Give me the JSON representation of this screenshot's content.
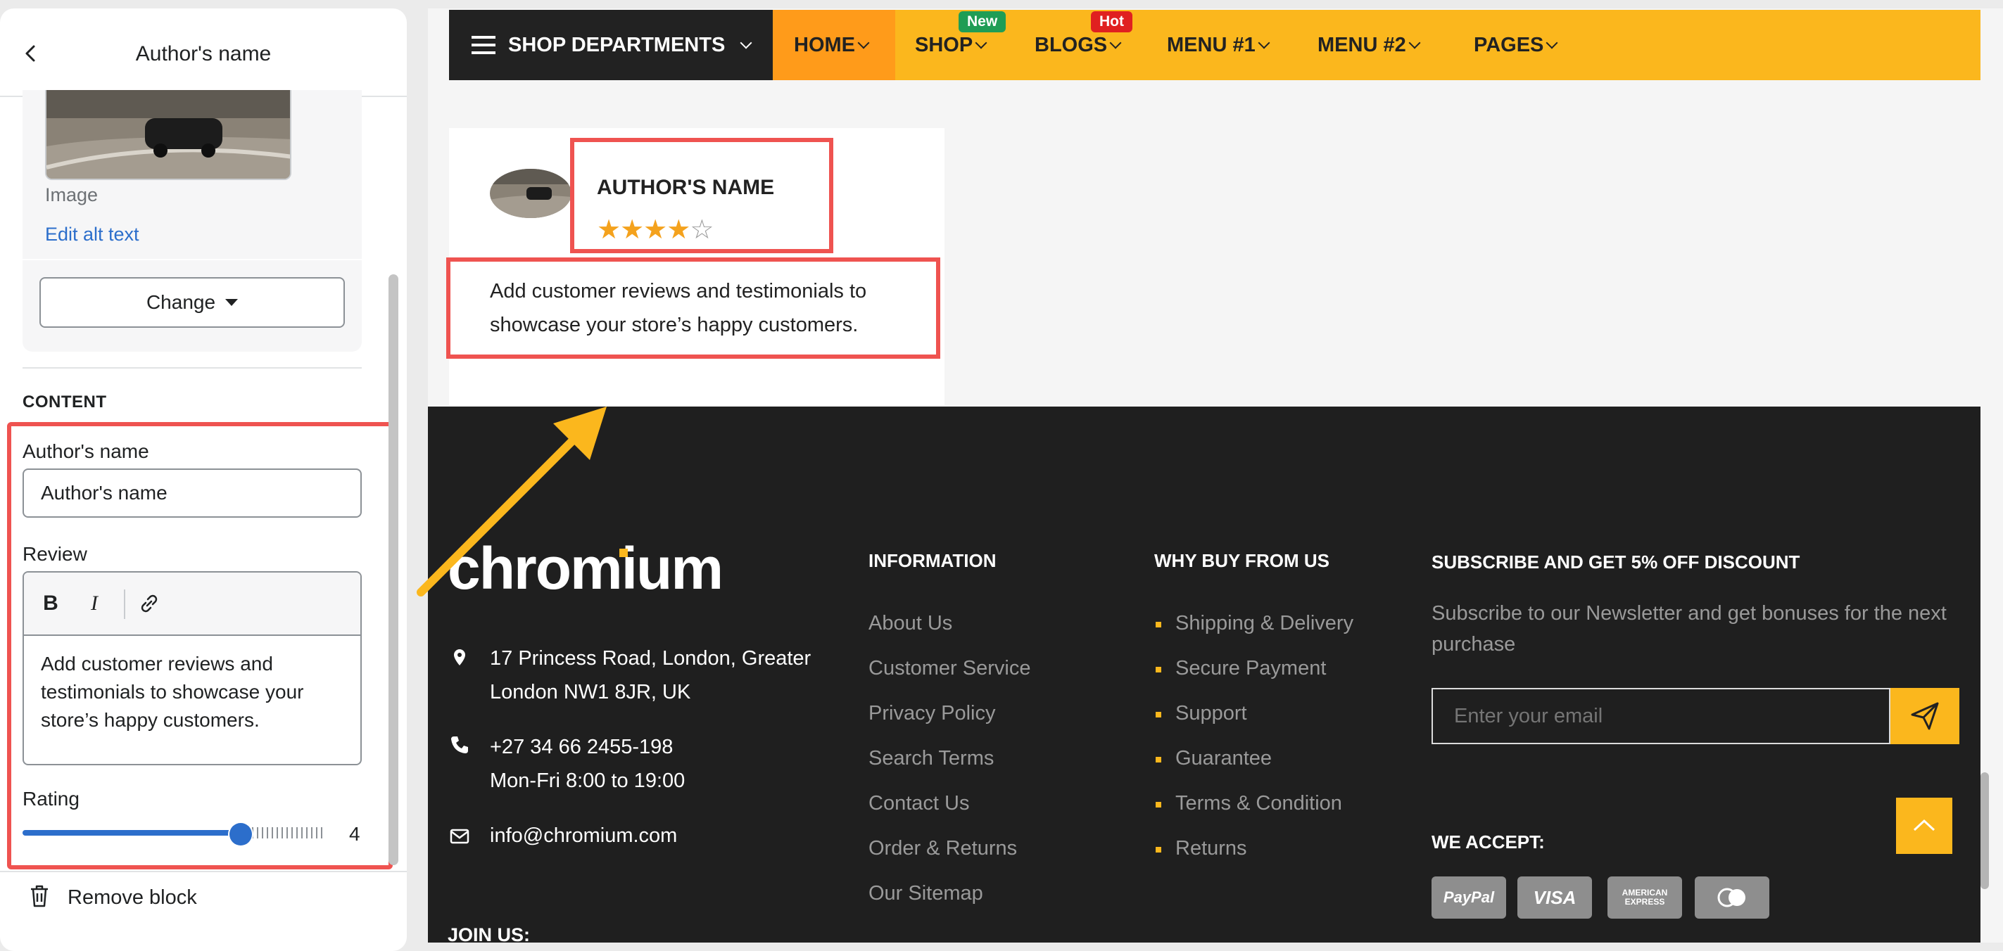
{
  "editor": {
    "title": "Author's name",
    "image_label": "Image",
    "edit_alt_text": "Edit alt text",
    "change_button": "Change",
    "content_heading": "CONTENT",
    "author_field_label": "Author's name",
    "author_field_value": "Author's name",
    "review_label": "Review",
    "toolbar": {
      "bold": "B",
      "italic": "I"
    },
    "review_text": "Add customer reviews and testimonials to showcase your store’s happy customers.",
    "rating_label": "Rating",
    "rating_value": "4",
    "rating_fraction": 0.8,
    "remove_block": "Remove block"
  },
  "nav": {
    "departments": "SHOP DEPARTMENTS",
    "items": [
      {
        "label": "HOME"
      },
      {
        "label": "SHOP",
        "badge": "New"
      },
      {
        "label": "BLOGS",
        "badge": "Hot"
      },
      {
        "label": "MENU #1"
      },
      {
        "label": "MENU #2"
      },
      {
        "label": "PAGES"
      }
    ],
    "colors": {
      "bar": "#fbb71d",
      "active": "#ff9b1a",
      "new_badge": "#1f9d55",
      "hot_badge": "#e02020"
    }
  },
  "testimonial": {
    "author": "AUTHOR'S NAME",
    "stars_filled": 4,
    "stars_total": 5,
    "review": "Add customer reviews and testimonials to showcase your store’s happy customers."
  },
  "footer": {
    "logo": "chromium",
    "address": [
      "17 Princess Road, London, Greater",
      "London NW1 8JR, UK"
    ],
    "phone": "+27 34 66 2455-198",
    "hours": "Mon-Fri 8:00 to 19:00",
    "email": "info@chromium.com",
    "join_heading": "JOIN US:",
    "information": {
      "heading": "INFORMATION",
      "links": [
        "About Us",
        "Customer Service",
        "Privacy Policy",
        "Search Terms",
        "Contact Us",
        "Order & Returns",
        "Our Sitemap"
      ]
    },
    "why_buy": {
      "heading": "WHY BUY FROM US",
      "links": [
        "Shipping & Delivery",
        "Secure Payment",
        "Support",
        "Guarantee",
        "Terms & Condition",
        "Returns"
      ]
    },
    "subscribe": {
      "heading": "SUBSCRIBE AND GET 5% OFF DISCOUNT",
      "description": "Subscribe to our Newsletter and get bonuses for the next purchase",
      "placeholder": "Enter your email"
    },
    "we_accept": "WE ACCEPT:",
    "payments": [
      "PayPal",
      "VISA",
      "AMERICAN EXPRESS",
      "mastercard"
    ]
  }
}
